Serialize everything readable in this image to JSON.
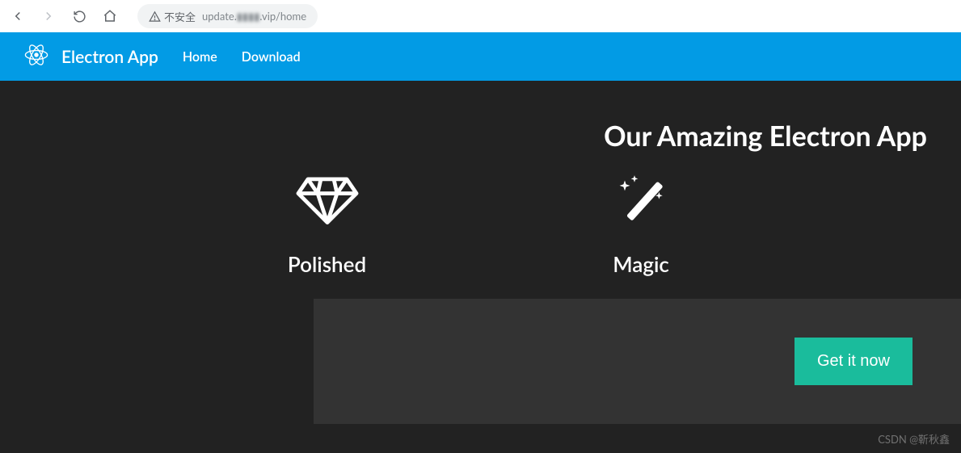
{
  "browser": {
    "insecure_label": "不安全",
    "url_prefix": "update.",
    "url_obscured": "▮▮▮▮",
    "url_suffix": ".vip/home"
  },
  "header": {
    "brand": "Electron App",
    "nav": {
      "home": "Home",
      "download": "Download"
    }
  },
  "hero": {
    "title": "Our Amazing Electron App",
    "features": {
      "polished": "Polished",
      "magic": "Magic"
    },
    "cta": "Get it now"
  },
  "watermark": "CSDN @靳秋鑫"
}
